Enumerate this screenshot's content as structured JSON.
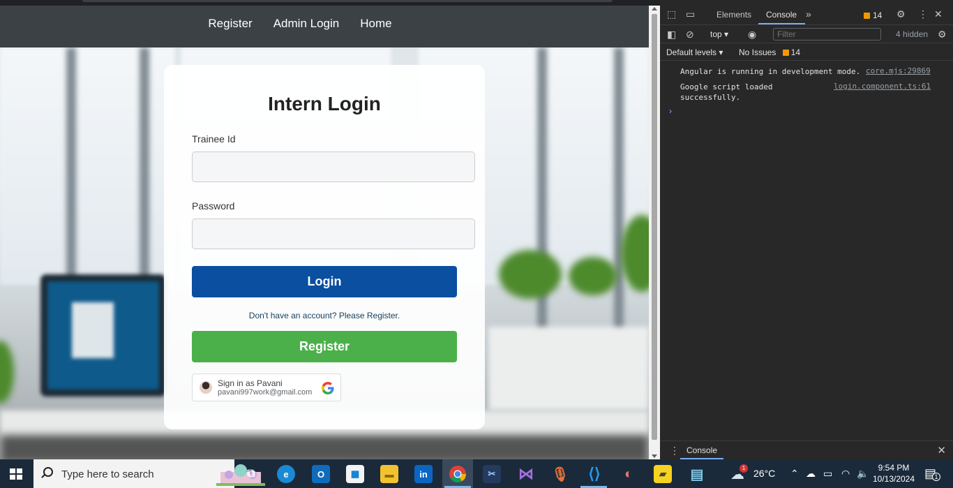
{
  "navbar": {
    "links": [
      "Register",
      "Admin Login",
      "Home"
    ]
  },
  "login_card": {
    "title": "Intern Login",
    "trainee_label": "Trainee Id",
    "trainee_value": "",
    "password_label": "Password",
    "password_value": "",
    "login_button": "Login",
    "register_prompt": "Don't have an account? Please Register.",
    "register_button": "Register",
    "google_signin": {
      "title": "Sign in as Pavani",
      "email": "pavani997work@gmail.com"
    }
  },
  "devtools": {
    "tabs": [
      "Elements",
      "Console"
    ],
    "active_tab": "Console",
    "issues_count": "14",
    "context": "top",
    "filter_placeholder": "Filter",
    "hidden_count": "4 hidden",
    "levels": "Default levels",
    "no_issues": "No Issues",
    "issues_badge": "14",
    "logs": [
      {
        "message": "Angular is running in development mode.",
        "source": "core.mjs:29869"
      },
      {
        "message_line1": "Google script loaded",
        "message_line2": "successfully.",
        "source": "login.component.ts:61"
      }
    ],
    "drawer_tab": "Console"
  },
  "taskbar": {
    "search_placeholder": "Type here to search",
    "weather": "26°C",
    "time": "9:54 PM",
    "date": "10/13/2024",
    "notifications": "1",
    "weather_badge": "1"
  },
  "colors": {
    "navbar": "#3c4146",
    "login_button": "#0a4fa0",
    "register_button": "#4cb04a",
    "devtools_bg": "#282828",
    "taskbar_bg": "#1b2a3a"
  }
}
